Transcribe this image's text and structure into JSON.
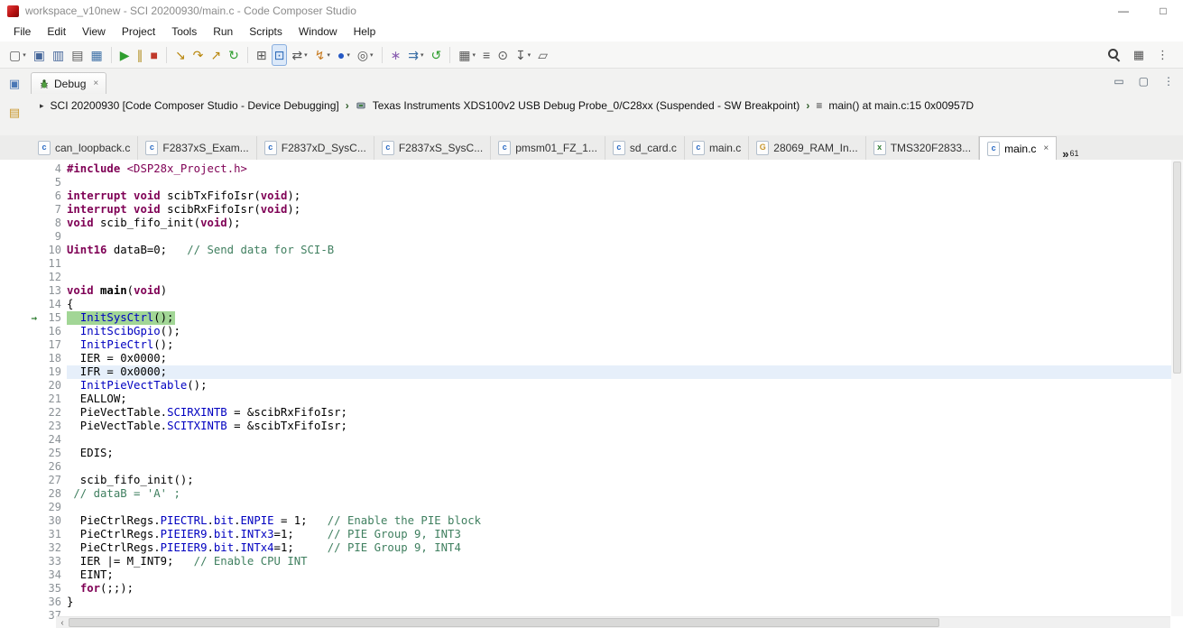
{
  "window": {
    "title": "workspace_v10new - SCI 20200930/main.c - Code Composer Studio"
  },
  "menubar": {
    "items": [
      "File",
      "Edit",
      "View",
      "Project",
      "Tools",
      "Run",
      "Scripts",
      "Window",
      "Help"
    ]
  },
  "icons": {
    "minimize": "—",
    "maximize": "□",
    "dropdown": "▾",
    "close": "×",
    "view_minimize": "▭",
    "view_maximize": "▢",
    "overflow_grip": "⋮",
    "perspective": "▦",
    "expander": "▸",
    "separator": "›",
    "stack_frame": "≡",
    "scroll_left": "‹",
    "tab_overflow_chevron": "»",
    "instruction_pointer": "→"
  },
  "toolbar": {
    "items": [
      {
        "name": "new-button",
        "icon": "new-file-icon",
        "glyph": "▢",
        "color": "#5a5a5a",
        "dropdown": true
      },
      {
        "name": "save-button",
        "icon": "save-icon",
        "glyph": "▣",
        "color": "#46679a"
      },
      {
        "name": "save-all-button",
        "icon": "save-all-icon",
        "glyph": "▥",
        "color": "#46679a"
      },
      {
        "name": "print-button",
        "icon": "print-icon",
        "glyph": "▤",
        "color": "#5a5a5a"
      },
      {
        "name": "show-console-button",
        "icon": "console-icon",
        "glyph": "▦",
        "color": "#3a6ea5"
      },
      {
        "sep": true
      },
      {
        "name": "resume-button",
        "icon": "resume-icon",
        "glyph": "▶",
        "color": "#2f9e2f"
      },
      {
        "name": "suspend-button",
        "icon": "suspend-icon",
        "glyph": "∥",
        "color": "#b08c1e"
      },
      {
        "name": "terminate-button",
        "icon": "terminate-icon",
        "glyph": "■",
        "color": "#c0392b"
      },
      {
        "sep": true
      },
      {
        "name": "step-into-button",
        "icon": "step-into-icon",
        "glyph": "↘",
        "color": "#b8860b"
      },
      {
        "name": "step-over-button",
        "icon": "step-over-icon",
        "glyph": "↷",
        "color": "#b8860b"
      },
      {
        "name": "step-return-button",
        "icon": "step-return-icon",
        "glyph": "↗",
        "color": "#b8860b"
      },
      {
        "name": "restart-button",
        "icon": "restart-icon",
        "glyph": "↻",
        "color": "#2f9e2f"
      },
      {
        "sep": true
      },
      {
        "name": "registers-button",
        "icon": "registers-grid-icon",
        "glyph": "⊞",
        "color": "#555555"
      },
      {
        "name": "connect-target-button",
        "icon": "connect-target-icon",
        "glyph": "⊡",
        "color": "#2e6bb8",
        "active": true
      },
      {
        "name": "source-lookup-button",
        "icon": "source-lookup-icon",
        "glyph": "⇄",
        "color": "#555555",
        "dropdown": true
      },
      {
        "name": "flash-button",
        "icon": "flash-icon",
        "glyph": "↯",
        "color": "#c77b21",
        "dropdown": true
      },
      {
        "name": "breakpoints-button",
        "icon": "breakpoint-icon",
        "glyph": "●",
        "color": "#2458c4",
        "dropdown": true
      },
      {
        "name": "watch-button",
        "icon": "watch-icon",
        "glyph": "◎",
        "color": "#555555",
        "dropdown": true
      },
      {
        "sep": true
      },
      {
        "name": "profile-button",
        "icon": "profile-icon",
        "glyph": "∗",
        "color": "#8a5fb0"
      },
      {
        "name": "trace-button",
        "icon": "trace-icon",
        "glyph": "⇉",
        "color": "#3a6ea5",
        "dropdown": true
      },
      {
        "name": "refresh-button",
        "icon": "refresh-icon",
        "glyph": "↺",
        "color": "#2f9e2f"
      },
      {
        "sep": true
      },
      {
        "name": "memory-button",
        "icon": "memory-icon",
        "glyph": "▦",
        "color": "#555555",
        "dropdown": true
      },
      {
        "name": "scripts-button",
        "icon": "scripts-icon",
        "glyph": "≡",
        "color": "#555555"
      },
      {
        "name": "search-source-button",
        "icon": "search-source-icon",
        "glyph": "⊙",
        "color": "#555555"
      },
      {
        "name": "pin-button",
        "icon": "pin-icon",
        "glyph": "↧",
        "color": "#555555",
        "dropdown": true
      },
      {
        "name": "compare-button",
        "icon": "compare-icon",
        "glyph": "▱",
        "color": "#555555"
      }
    ]
  },
  "left_rail": {
    "icons": [
      {
        "name": "restore-view-button",
        "icon": "restore-view-icon",
        "glyph": "▣",
        "color": "#4a78b5"
      },
      {
        "name": "open-resource-button",
        "icon": "folder-icon",
        "glyph": "▤",
        "color": "#c9972c"
      }
    ]
  },
  "debug_view": {
    "tab": "Debug",
    "breadcrumb": {
      "session": "SCI 20200930 [Code Composer Studio - Device Debugging]",
      "probe": "Texas Instruments XDS100v2 USB Debug Probe_0/C28xx (Suspended - SW Breakpoint)",
      "frame": "main() at main.c:15 0x00957D"
    }
  },
  "editor": {
    "hidden_tabs_count": "61",
    "tabs": [
      {
        "label": "can_loopback.c",
        "icon": "c-file",
        "icon_glyph": "c",
        "icon_color": "#2a6bc4"
      },
      {
        "label": "F2837xS_Exam...",
        "icon": "c-file",
        "icon_glyph": "c",
        "icon_color": "#2a6bc4"
      },
      {
        "label": "F2837xD_SysC...",
        "icon": "c-file",
        "icon_glyph": "c",
        "icon_color": "#2a6bc4"
      },
      {
        "label": "F2837xS_SysC...",
        "icon": "c-file",
        "icon_glyph": "c",
        "icon_color": "#2a6bc4"
      },
      {
        "label": "pmsm01_FZ_1...",
        "icon": "c-file",
        "icon_glyph": "c",
        "icon_color": "#2a6bc4"
      },
      {
        "label": "sd_card.c",
        "icon": "c-file",
        "icon_glyph": "c",
        "icon_color": "#2a6bc4"
      },
      {
        "label": "main.c",
        "icon": "c-file",
        "icon_glyph": "c",
        "icon_color": "#2a6bc4"
      },
      {
        "label": "28069_RAM_In...",
        "icon": "gel-file",
        "icon_glyph": "G",
        "icon_color": "#c9972c"
      },
      {
        "label": "TMS320F2833...",
        "icon": "ccxml-file",
        "icon_glyph": "x",
        "icon_color": "#2e7d32"
      },
      {
        "label": "main.c",
        "icon": "c-file",
        "icon_glyph": "c",
        "icon_color": "#2a6bc4",
        "active": true
      }
    ],
    "code": {
      "lines": [
        {
          "n": 4,
          "s": [
            [
              "k",
              "#include"
            ],
            [
              "n",
              " "
            ],
            [
              "h",
              "<DSP28x_Project.h>"
            ]
          ]
        },
        {
          "n": 5,
          "s": []
        },
        {
          "n": 6,
          "s": [
            [
              "k",
              "interrupt"
            ],
            [
              "n",
              " "
            ],
            [
              "k",
              "void"
            ],
            [
              "n",
              " scibTxFifoIsr("
            ],
            [
              "k",
              "void"
            ],
            [
              "n",
              ");"
            ]
          ]
        },
        {
          "n": 7,
          "s": [
            [
              "k",
              "interrupt"
            ],
            [
              "n",
              " "
            ],
            [
              "k",
              "void"
            ],
            [
              "n",
              " scibRxFifoIsr("
            ],
            [
              "k",
              "void"
            ],
            [
              "n",
              ");"
            ]
          ]
        },
        {
          "n": 8,
          "s": [
            [
              "k",
              "void"
            ],
            [
              "n",
              " scib_fifo_init("
            ],
            [
              "k",
              "void"
            ],
            [
              "n",
              ");"
            ]
          ]
        },
        {
          "n": 9,
          "s": []
        },
        {
          "n": 10,
          "s": [
            [
              "k",
              "Uint16"
            ],
            [
              "n",
              " dataB=0;   "
            ],
            [
              "c",
              "// Send data for SCI-B"
            ]
          ]
        },
        {
          "n": 11,
          "s": []
        },
        {
          "n": 12,
          "s": []
        },
        {
          "n": 13,
          "s": [
            [
              "k",
              "void"
            ],
            [
              "n",
              " "
            ],
            [
              "bd",
              "main"
            ],
            [
              "n",
              "("
            ],
            [
              "k",
              "void"
            ],
            [
              "n",
              ")"
            ]
          ]
        },
        {
          "n": 14,
          "s": [
            [
              "n",
              "{"
            ]
          ]
        },
        {
          "n": 15,
          "h": "exec",
          "ip": true,
          "s": [
            [
              "n",
              "  "
            ],
            [
              "b",
              "InitSysCtrl"
            ],
            [
              "n",
              "();"
            ]
          ]
        },
        {
          "n": 16,
          "s": [
            [
              "n",
              "  "
            ],
            [
              "b",
              "InitScibGpio"
            ],
            [
              "n",
              "();"
            ]
          ]
        },
        {
          "n": 17,
          "s": [
            [
              "n",
              "  "
            ],
            [
              "b",
              "InitPieCtrl"
            ],
            [
              "n",
              "();"
            ]
          ]
        },
        {
          "n": 18,
          "s": [
            [
              "n",
              "  IER = 0x0000;"
            ]
          ]
        },
        {
          "n": 19,
          "h": "cursor",
          "s": [
            [
              "n",
              "  IFR = 0x0000;"
            ]
          ]
        },
        {
          "n": 20,
          "s": [
            [
              "n",
              "  "
            ],
            [
              "b",
              "InitPieVectTable"
            ],
            [
              "n",
              "();"
            ]
          ]
        },
        {
          "n": 21,
          "s": [
            [
              "n",
              "  EALLOW;"
            ]
          ]
        },
        {
          "n": 22,
          "s": [
            [
              "n",
              "  PieVectTable."
            ],
            [
              "b",
              "SCIRXINTB"
            ],
            [
              "n",
              " = &scibRxFifoIsr;"
            ]
          ]
        },
        {
          "n": 23,
          "s": [
            [
              "n",
              "  PieVectTable."
            ],
            [
              "b",
              "SCITXINTB"
            ],
            [
              "n",
              " = &scibTxFifoIsr;"
            ]
          ]
        },
        {
          "n": 24,
          "s": []
        },
        {
          "n": 25,
          "s": [
            [
              "n",
              "  EDIS;"
            ]
          ]
        },
        {
          "n": 26,
          "s": []
        },
        {
          "n": 27,
          "s": [
            [
              "n",
              "  scib_fifo_init();"
            ]
          ]
        },
        {
          "n": 28,
          "s": [
            [
              "n",
              " "
            ],
            [
              "c",
              "// dataB = 'A' ;"
            ]
          ]
        },
        {
          "n": 29,
          "s": []
        },
        {
          "n": 30,
          "s": [
            [
              "n",
              "  PieCtrlRegs."
            ],
            [
              "b",
              "PIECTRL"
            ],
            [
              "n",
              "."
            ],
            [
              "b",
              "bit"
            ],
            [
              "n",
              "."
            ],
            [
              "b",
              "ENPIE"
            ],
            [
              "n",
              " = 1;   "
            ],
            [
              "c",
              "// Enable the PIE block"
            ]
          ]
        },
        {
          "n": 31,
          "s": [
            [
              "n",
              "  PieCtrlRegs."
            ],
            [
              "b",
              "PIEIER9"
            ],
            [
              "n",
              "."
            ],
            [
              "b",
              "bit"
            ],
            [
              "n",
              "."
            ],
            [
              "b",
              "INTx3"
            ],
            [
              "n",
              "=1;     "
            ],
            [
              "c",
              "// PIE Group 9, INT3"
            ]
          ]
        },
        {
          "n": 32,
          "s": [
            [
              "n",
              "  PieCtrlRegs."
            ],
            [
              "b",
              "PIEIER9"
            ],
            [
              "n",
              "."
            ],
            [
              "b",
              "bit"
            ],
            [
              "n",
              "."
            ],
            [
              "b",
              "INTx4"
            ],
            [
              "n",
              "=1;     "
            ],
            [
              "c",
              "// PIE Group 9, INT4"
            ]
          ]
        },
        {
          "n": 33,
          "s": [
            [
              "n",
              "  IER |= M_INT9;   "
            ],
            [
              "c",
              "// Enable CPU INT"
            ]
          ]
        },
        {
          "n": 34,
          "s": [
            [
              "n",
              "  EINT;"
            ]
          ]
        },
        {
          "n": 35,
          "s": [
            [
              "n",
              "  "
            ],
            [
              "k",
              "for"
            ],
            [
              "n",
              "(;;);"
            ]
          ]
        },
        {
          "n": 36,
          "s": [
            [
              "n",
              "}"
            ]
          ]
        },
        {
          "n": 37,
          "s": []
        }
      ]
    }
  },
  "colors": {
    "keyword": "#7f0055",
    "comment": "#3f7f5f",
    "member": "#0000c0",
    "exec_line_highlight": "#a2d696",
    "cursor_line_highlight": "#e6effa",
    "app_brand": "#b40f0f"
  }
}
